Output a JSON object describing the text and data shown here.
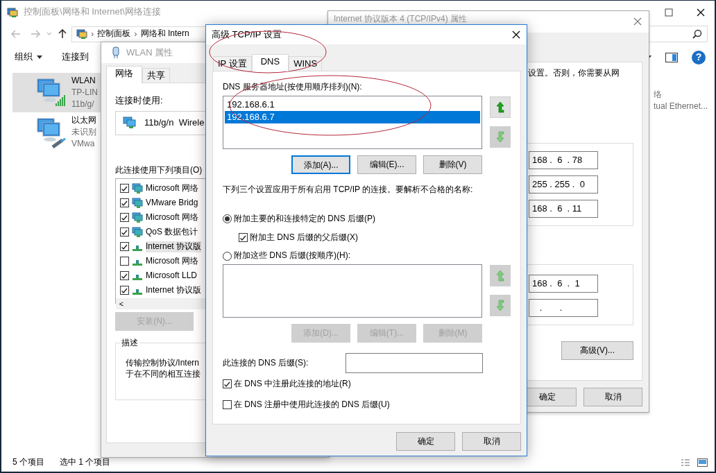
{
  "explorer": {
    "title": "控制面板\\网络和 Internet\\网络连接",
    "address": {
      "separator": "›",
      "segments": [
        "控制面板",
        "网络和 Intern"
      ]
    },
    "toolbar": [
      "组织",
      "连接到"
    ],
    "help_glyph": "?",
    "connections": [
      {
        "name": "WLAN",
        "lines": [
          "TP-LIN",
          "11b/g/"
        ],
        "kind": "wifi",
        "selected": true
      },
      {
        "name": "以太网",
        "lines": [
          "未识别",
          "VMwa"
        ],
        "kind": "ethernet",
        "selected": false
      }
    ],
    "partial_connection": [
      "络",
      "tual Ethernet..."
    ],
    "status_bar": [
      "5 个项目",
      "选中 1 个项目"
    ]
  },
  "wlan_properties": {
    "title": "WLAN 属性",
    "tabs": [
      {
        "label": "网络",
        "selected": true
      },
      {
        "label": "共享",
        "selected": false
      }
    ],
    "connect_using_label": "连接时使用:",
    "adapter": "11b/g/n  Wirele",
    "items_label": "此连接使用下列项目(O)",
    "components": [
      {
        "label": "Microsoft 网络",
        "kind": "client",
        "checked": true,
        "selected": false
      },
      {
        "label": "VMware Bridg",
        "kind": "client",
        "checked": true,
        "selected": false
      },
      {
        "label": "Microsoft 网络",
        "kind": "client",
        "checked": true,
        "selected": false
      },
      {
        "label": "QoS 数据包计",
        "kind": "client",
        "checked": true,
        "selected": false
      },
      {
        "label": "Internet 协议版",
        "kind": "protocol",
        "checked": true,
        "selected": true
      },
      {
        "label": "Microsoft 网络",
        "kind": "protocol",
        "checked": false,
        "selected": false
      },
      {
        "label": "Microsoft LLD",
        "kind": "protocol",
        "checked": true,
        "selected": false
      },
      {
        "label": "Internet 协议版",
        "kind": "protocol",
        "checked": true,
        "selected": false
      }
    ],
    "scroll_left": "<",
    "install_button": {
      "label": "安装(N)...",
      "disabled": true
    },
    "description": {
      "legend": "描述",
      "lines": [
        "传输控制协议/Intern",
        "于在不同的相互连接"
      ]
    }
  },
  "ipv4_properties": {
    "title": "Internet 协议版本 4 (TCP/IPv4) 属性",
    "intro": "设置。否则，你需要从网",
    "address_fields": [
      "168 .  6  . 78",
      "255 . 255 .  0",
      "168 .  6  . 11"
    ],
    "dns_fields": [
      "168 .  6  .  1",
      "   .       .   "
    ],
    "advanced_button": "高级(V)...",
    "footer_buttons": [
      "确定",
      "取消"
    ]
  },
  "advanced_dialog": {
    "title": "高级 TCP/IP 设置",
    "tabs": [
      {
        "label": "IP 设置",
        "selected": false
      },
      {
        "label": "DNS",
        "selected": true
      },
      {
        "label": "WINS",
        "selected": false
      }
    ],
    "dns_servers_label": "DNS 服务器地址(按使用顺序排列)(N):",
    "dns_servers": [
      {
        "address": "192.168.6.1",
        "selected": false
      },
      {
        "address": "192.168.6.7",
        "selected": true
      }
    ],
    "server_move_buttons": [
      {
        "kind": "up",
        "disabled": false
      },
      {
        "kind": "down",
        "disabled": true
      }
    ],
    "server_buttons": [
      {
        "label": "添加(A)...",
        "disabled": false,
        "focused": true
      },
      {
        "label": "编辑(E)...",
        "disabled": false,
        "focused": false
      },
      {
        "label": "删除(V)",
        "disabled": false,
        "focused": false
      }
    ],
    "note": "下列三个设置应用于所有启用 TCP/IP 的连接。要解析不合格的名称:",
    "primary_suffix_option": {
      "label": "附加主要的和连接特定的 DNS 后缀(P)",
      "selected": true
    },
    "parent_suffix": {
      "label": "附加主 DNS 后缀的父后缀(X)",
      "checked": true
    },
    "custom_suffix_option": {
      "label": "附加这些 DNS 后缀(按顺序)(H):",
      "selected": false
    },
    "suffix_move_buttons": [
      {
        "kind": "up",
        "disabled": true
      },
      {
        "kind": "down",
        "disabled": true
      }
    ],
    "suffix_buttons": [
      {
        "label": "添加(D)...",
        "disabled": true,
        "focused": false
      },
      {
        "label": "编辑(T)...",
        "disabled": true,
        "focused": false
      },
      {
        "label": "删除(M)",
        "disabled": true,
        "focused": false
      }
    ],
    "connection_suffix_label": "此连接的 DNS 后缀(S):",
    "register_options": [
      {
        "label": "在 DNS 中注册此连接的地址(R)",
        "checked": true
      },
      {
        "label": "在 DNS 注册中使用此连接的 DNS 后缀(U)",
        "checked": false
      }
    ],
    "footer_buttons": [
      "确定",
      "取消"
    ]
  }
}
